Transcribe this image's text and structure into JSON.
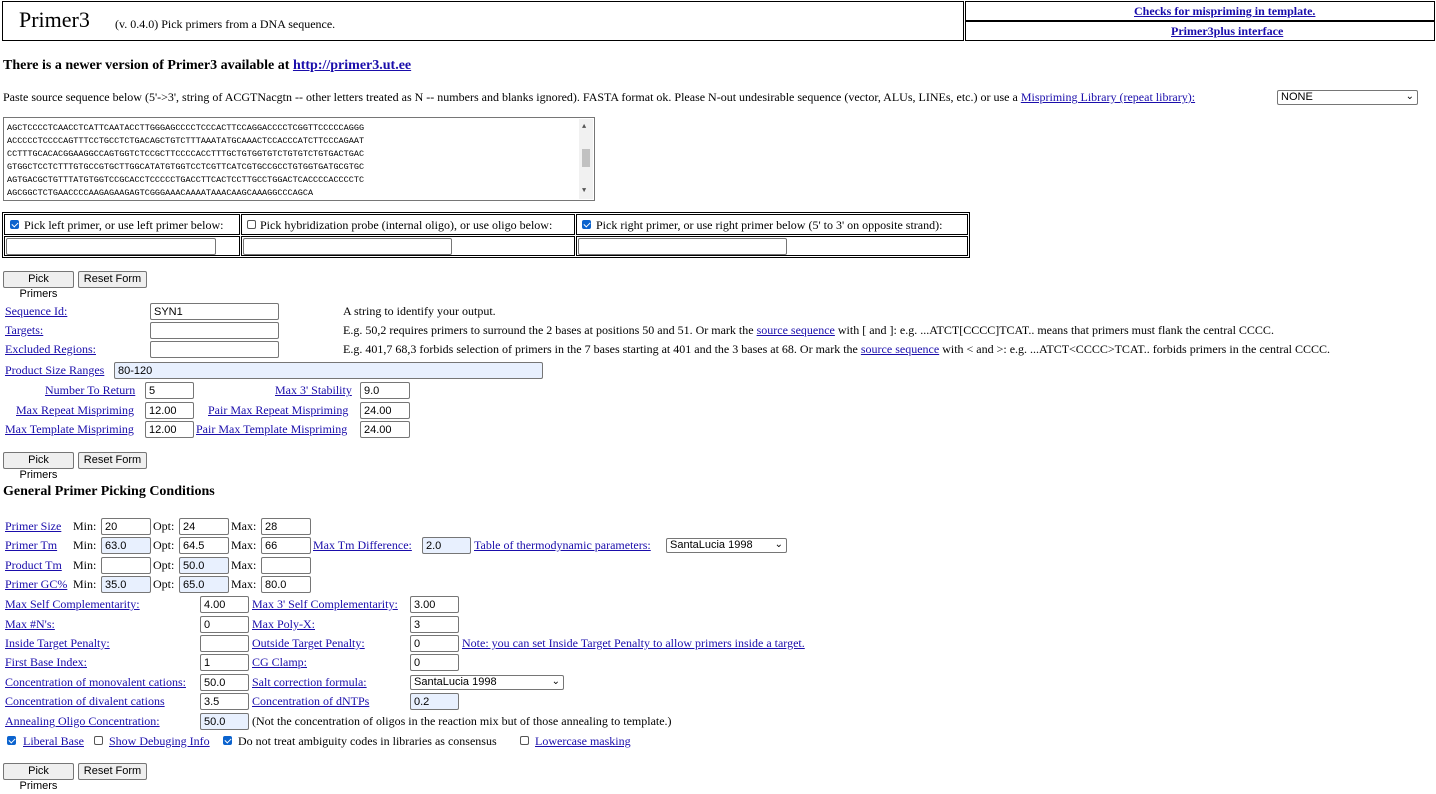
{
  "header": {
    "title": "Primer3",
    "version": "(v. 0.4.0) Pick primers from a DNA sequence.",
    "link1": "Checks for mispriming in template.",
    "link2": "Primer3plus interface"
  },
  "notice": {
    "text": "There is a newer version of Primer3 available at ",
    "url": "http://primer3.ut.ee"
  },
  "intro": {
    "text": "Paste source sequence below (5'->3', string of ACGTNacgtn -- other letters treated as N -- numbers and blanks ignored). FASTA format ok. Please N-out undesirable sequence (vector, ALUs, LINEs, etc.) or use a ",
    "link": "Mispriming Library (repeat library):",
    "library_value": "NONE"
  },
  "sequence_lines": [
    "AGCTCCCCTCAACCTCATTCAATACCTTGGGAGCCCCTCCCACTTCCAGGACCCCTCGGTTCCCCCAGGG",
    "ACCCCCTCCCCAGTTTCCTGCCTCTGACAGCTGTCTTTAAATATGCAAACTCCACCCATCTTCCCAGAAT",
    "CCTTTGCACACGGAAGGCCAGTGGTCTCCGCTTCCCCACCTTTGCTGTGGTGTCTGTGTCTGTGACTGAC",
    "GTGGCTCCTCTTTGTGCCGTGCTTGGCATATGTGGTCCTCGTTCATCGTGCCGCCTGTGGTGATGCGTGC",
    "AGTGACGCTGTTTATGTGGTCCGCACCTCCCCCTGACCTTCACTCCTTGCCTGGACTCACCCCACCCCTC",
    "AGCGGCTCTGAACCCCAAGAGAAGAGTCGGGAAACAAAATAAACAAGCAAAGGCCCAGCA"
  ],
  "pick": {
    "left_label": "Pick left primer, or use left primer below:",
    "left_checked": true,
    "probe_label": "Pick hybridization probe (internal oligo), or use oligo below:",
    "probe_checked": false,
    "right_label": "Pick right primer, or use right primer below (5' to 3' on opposite strand):",
    "right_checked": true
  },
  "buttons": {
    "pick": "Pick Primers",
    "reset": "Reset Form"
  },
  "seqid": {
    "label": "Sequence Id:",
    "value": "SYN1",
    "desc": "A string to identify your output."
  },
  "targets": {
    "label": "Targets:",
    "value": "",
    "desc_a": "E.g. 50,2 requires primers to surround the 2 bases at positions 50 and 51. Or mark the ",
    "desc_link": "source sequence",
    "desc_b": " with [ and ]: e.g. ...ATCT[CCCC]TCAT.. means that primers must flank the central CCCC."
  },
  "excluded": {
    "label": "Excluded Regions:",
    "value": "",
    "desc_a": "E.g. 401,7 68,3 forbids selection of primers in the 7 bases starting at 401 and the 3 bases at 68. Or mark the ",
    "desc_link": "source sequence",
    "desc_b": " with < and >: e.g. ...ATCT<CCCC>TCAT.. forbids primers in the central CCCC."
  },
  "product_size": {
    "label": "Product Size Ranges",
    "value": "80-120"
  },
  "num_return": {
    "label": "Number To Return",
    "value": "5"
  },
  "max3stab": {
    "label": "Max 3' Stability",
    "value": "9.0"
  },
  "max_repeat": {
    "label": "Max Repeat Mispriming",
    "value": "12.00"
  },
  "pair_max_repeat": {
    "label": "Pair Max Repeat Mispriming",
    "value": "24.00"
  },
  "max_template": {
    "label": "Max Template Mispriming",
    "value": "12.00"
  },
  "pair_max_template": {
    "label": "Pair Max Template Mispriming",
    "value": "24.00"
  },
  "general": {
    "heading": "General Primer Picking Conditions",
    "min": "Min:",
    "opt": "Opt:",
    "max": "Max:",
    "primer_size": {
      "label": "Primer Size",
      "min": "20",
      "opt": "24",
      "max": "28"
    },
    "primer_tm": {
      "label": "Primer Tm",
      "min": "63.0",
      "opt": "64.5",
      "max": "66"
    },
    "max_tm_diff": {
      "label": "Max Tm Difference:",
      "value": "2.0"
    },
    "thermo": {
      "label": "Table of thermodynamic parameters:",
      "value": "SantaLucia 1998"
    },
    "product_tm": {
      "label": "Product Tm",
      "min": "",
      "opt": "50.0",
      "max": ""
    },
    "primer_gc": {
      "label": "Primer GC%",
      "min": "35.0",
      "opt": "65.0",
      "max": "80.0"
    },
    "max_self_comp": {
      "label": "Max Self Complementarity:",
      "value": "4.00"
    },
    "max3_self_comp": {
      "label": "Max 3' Self Complementarity:",
      "value": "3.00"
    },
    "max_ns": {
      "label": "Max #N's:",
      "value": "0"
    },
    "max_polyx": {
      "label": "Max Poly-X:",
      "value": "3"
    },
    "inside_pen": {
      "label": "Inside Target Penalty:",
      "value": ""
    },
    "outside_pen": {
      "label": "Outside Target Penalty:",
      "value": "0"
    },
    "note": "Note: you can set Inside Target Penalty to allow primers inside a target.",
    "first_base": {
      "label": "First Base Index:",
      "value": "1"
    },
    "cg_clamp": {
      "label": "CG Clamp:",
      "value": "0"
    },
    "mono": {
      "label": "Concentration of monovalent cations:",
      "value": "50.0"
    },
    "salt": {
      "label": "Salt correction formula:",
      "value": "SantaLucia 1998"
    },
    "divalent": {
      "label": "Concentration of divalent cations",
      "value": "3.5"
    },
    "dntp": {
      "label": "Concentration of dNTPs",
      "value": "0.2"
    },
    "anneal": {
      "label": "Annealing Oligo Concentration:",
      "value": "50.0",
      "note": "(Not the concentration of oligos in the reaction mix but of those annealing to template.)"
    }
  },
  "options": {
    "liberal": {
      "label": "Liberal Base",
      "checked": true
    },
    "debug": {
      "label": "Show Debuging Info",
      "checked": false
    },
    "ambig": {
      "label": "Do not treat ambiguity codes in libraries as consensus",
      "checked": true
    },
    "lower": {
      "label": "Lowercase masking",
      "checked": false
    }
  }
}
